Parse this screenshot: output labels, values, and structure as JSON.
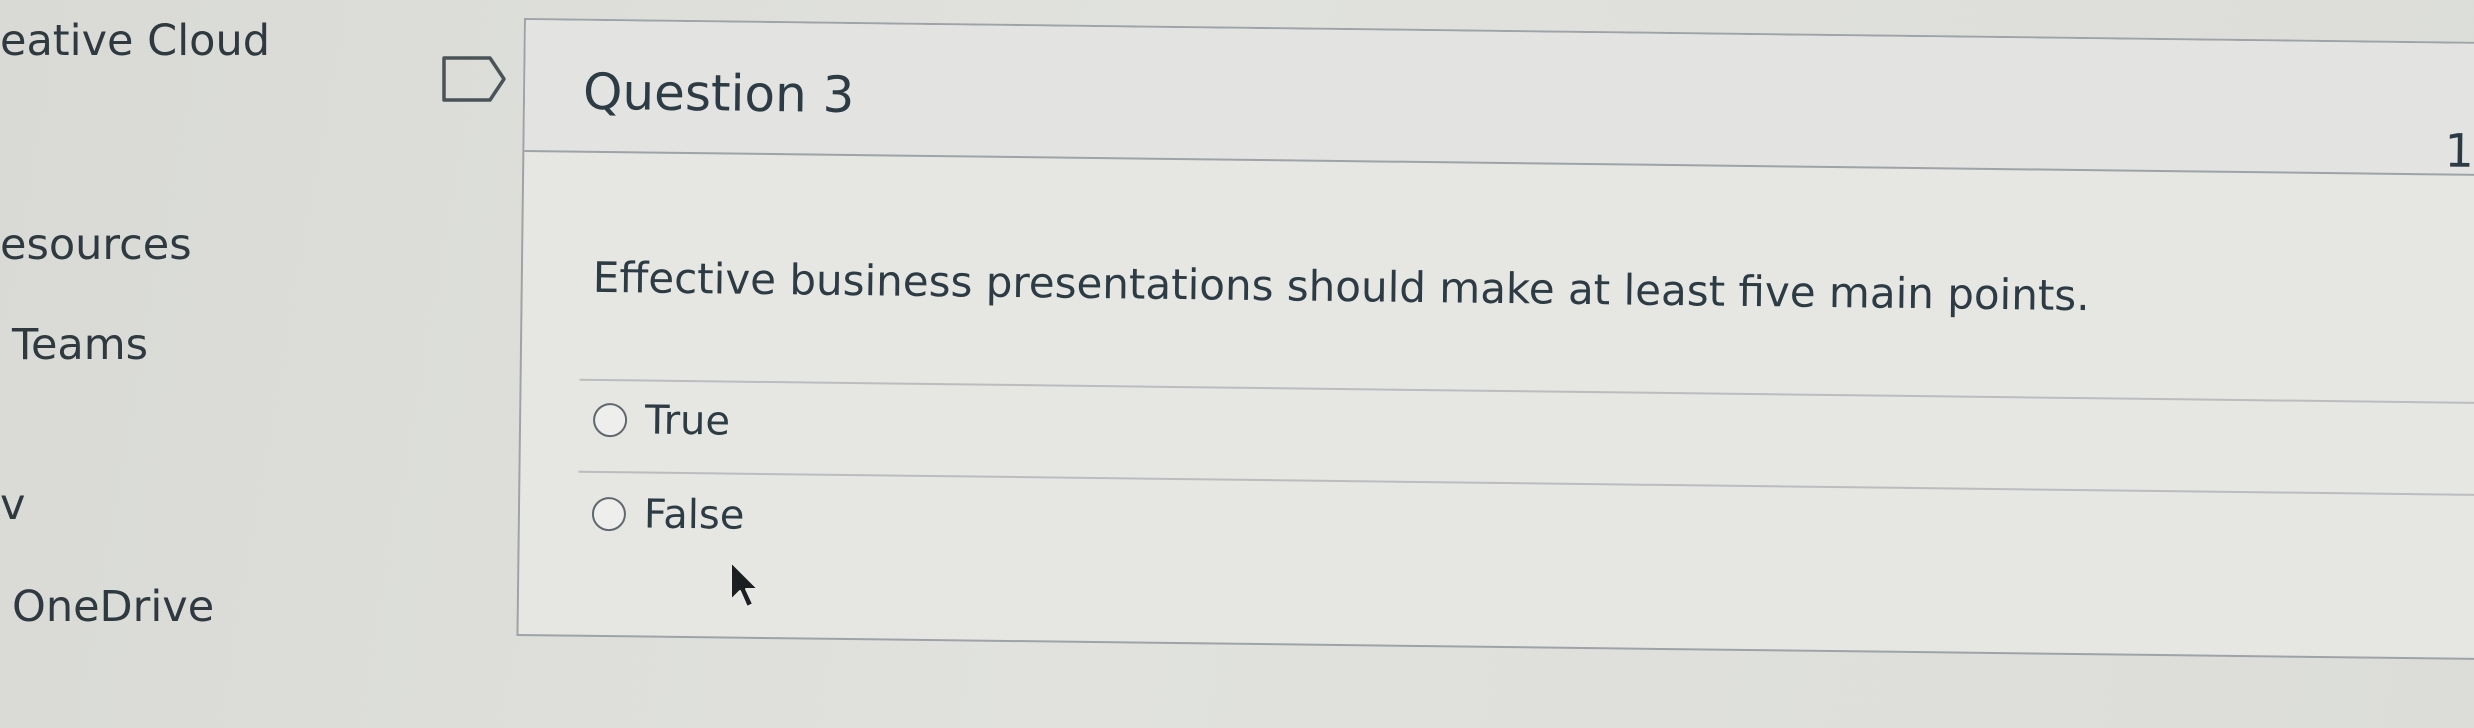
{
  "sidebar": {
    "items": [
      {
        "label": "eative Cloud"
      },
      {
        "label": "esources"
      },
      {
        "label": "Teams"
      },
      {
        "label": "v"
      },
      {
        "label": "OneDrive"
      }
    ]
  },
  "flag": {
    "icon": "bookmark-flag-icon"
  },
  "question": {
    "title": "Question 3",
    "points": "1",
    "text": "Effective business presentations should make at least five main points.",
    "answers": [
      {
        "label": "True",
        "selected": false
      },
      {
        "label": "False",
        "selected": false
      }
    ]
  },
  "cursor": {
    "icon": "mouse-pointer-icon"
  }
}
